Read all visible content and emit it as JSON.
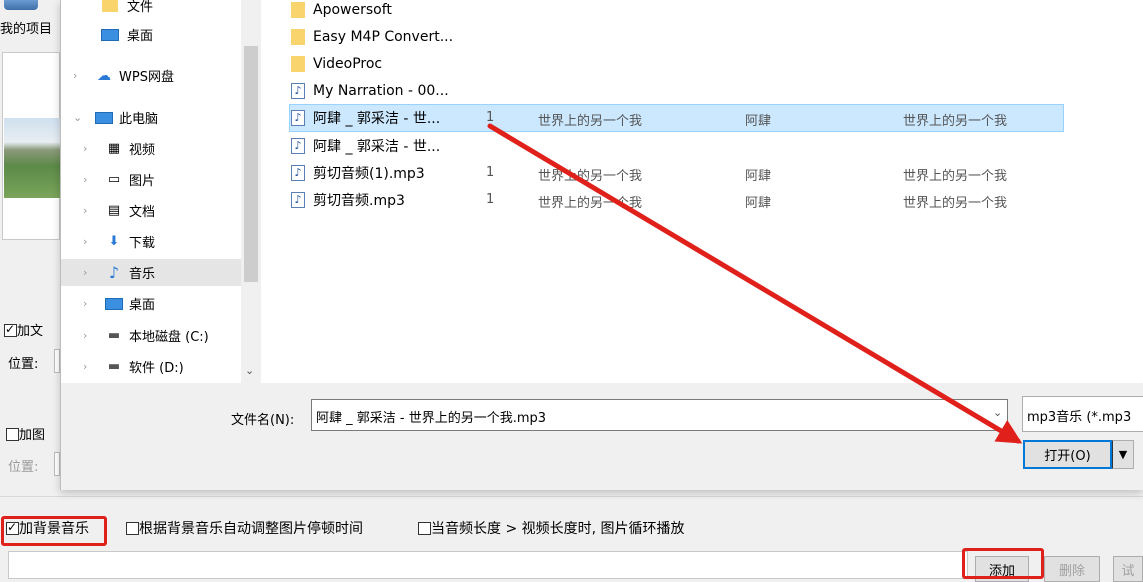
{
  "background_app": {
    "project_label": "我的项目",
    "add_text_label": "加文",
    "position_label": "位置:",
    "add_image_label": "加图",
    "position_label_2": "位置:",
    "add_music_label": "加背景音乐",
    "auto_adjust_label": "根据背景音乐自动调整图片停顿时间",
    "loop_label_a": "当音频长度",
    "loop_label_gt": ">",
    "loop_label_b": "视频长度时, 图片循环播放",
    "add_button": "添加",
    "delete_button": "删除",
    "try_button": "试"
  },
  "dialog": {
    "nav": [
      {
        "label": "文件",
        "icon": "folder-icon"
      },
      {
        "label": "桌面",
        "icon": "desktop-icon"
      },
      {
        "label": "WPS网盘",
        "icon": "cloud-icon"
      },
      {
        "label": "此电脑",
        "icon": "computer-icon"
      },
      {
        "label": "视频",
        "icon": "video-icon"
      },
      {
        "label": "图片",
        "icon": "pictures-icon"
      },
      {
        "label": "文档",
        "icon": "document-icon"
      },
      {
        "label": "下载",
        "icon": "download-icon"
      },
      {
        "label": "音乐",
        "icon": "music-icon"
      },
      {
        "label": "桌面",
        "icon": "desktop-icon"
      },
      {
        "label": "本地磁盘 (C:)",
        "icon": "drive-icon"
      },
      {
        "label": "软件 (D:)",
        "icon": "drive-icon"
      }
    ],
    "files": [
      {
        "name": "Apowersoft",
        "type": "folder"
      },
      {
        "name": "Easy M4P Convert...",
        "type": "folder"
      },
      {
        "name": "VideoProc",
        "type": "folder"
      },
      {
        "name": "My Narration - 00...",
        "type": "music"
      },
      {
        "name": "阿肆 _ 郭采洁 - 世...",
        "type": "music",
        "num": "1",
        "title": "世界上的另一个我",
        "artist": "阿肆",
        "album": "世界上的另一个我",
        "selected": true
      },
      {
        "name": "阿肆 _ 郭采洁 - 世...",
        "type": "music"
      },
      {
        "name": "剪切音频(1).mp3",
        "type": "music",
        "num": "1",
        "title": "世界上的另一个我",
        "artist": "阿肆",
        "album": "世界上的另一个我"
      },
      {
        "name": "剪切音频.mp3",
        "type": "music",
        "num": "1",
        "title": "世界上的另一个我",
        "artist": "阿肆",
        "album": "世界上的另一个我"
      }
    ],
    "filename_label": "文件名(N):",
    "filename_value": "阿肆 _ 郭采洁 - 世界上的另一个我.mp3",
    "filter_value": "mp3音乐 (*.mp3",
    "open_button": "打开(O)"
  },
  "colors": {
    "selection": "#cce8ff",
    "highlight": "#e0201a",
    "accent": "#0078d7"
  }
}
